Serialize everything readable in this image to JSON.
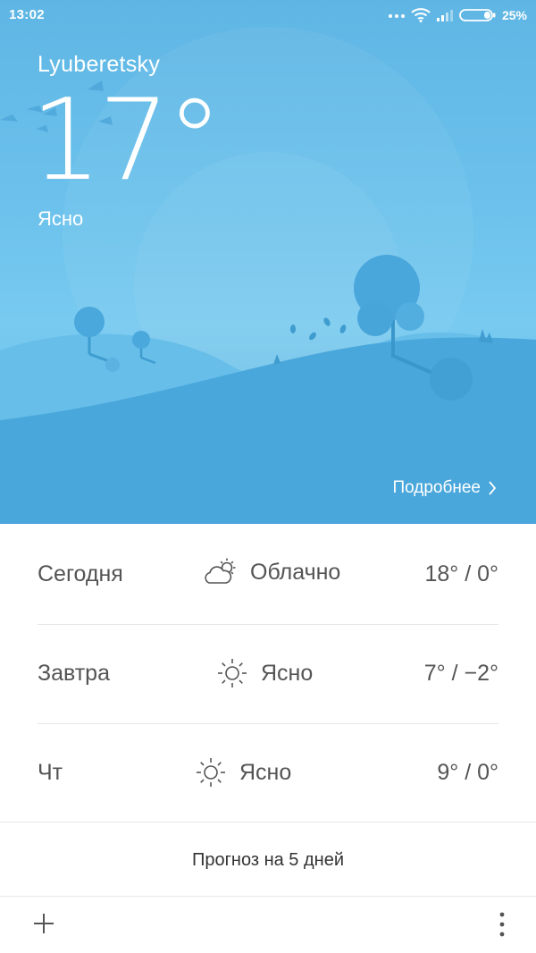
{
  "status_bar": {
    "time": "13:02",
    "battery_percent": "25%",
    "icons": [
      "more-dots-icon",
      "wifi-icon",
      "signal-icon",
      "battery-icon"
    ]
  },
  "current": {
    "city": "Lyuberetsky",
    "temperature": "17°",
    "condition": "Ясно"
  },
  "details_link": "Подробнее",
  "forecast": [
    {
      "day": "Сегодня",
      "icon": "partly-cloudy-icon",
      "condition": "Облачно",
      "range": "18° / 0°"
    },
    {
      "day": "Завтра",
      "icon": "sun-icon",
      "condition": "Ясно",
      "range": "7° / −2°"
    },
    {
      "day": "Чт",
      "icon": "sun-icon",
      "condition": "Ясно",
      "range": "9° / 0°"
    }
  ],
  "five_day_button": "Прогноз на 5 дней",
  "bottom_bar": {
    "add_icon": "plus-icon",
    "menu_icon": "vertical-dots-icon"
  },
  "colors": {
    "sky_top": "#5fb6e4",
    "sky_bottom": "#5bb3e2",
    "text_dark": "#545454"
  }
}
